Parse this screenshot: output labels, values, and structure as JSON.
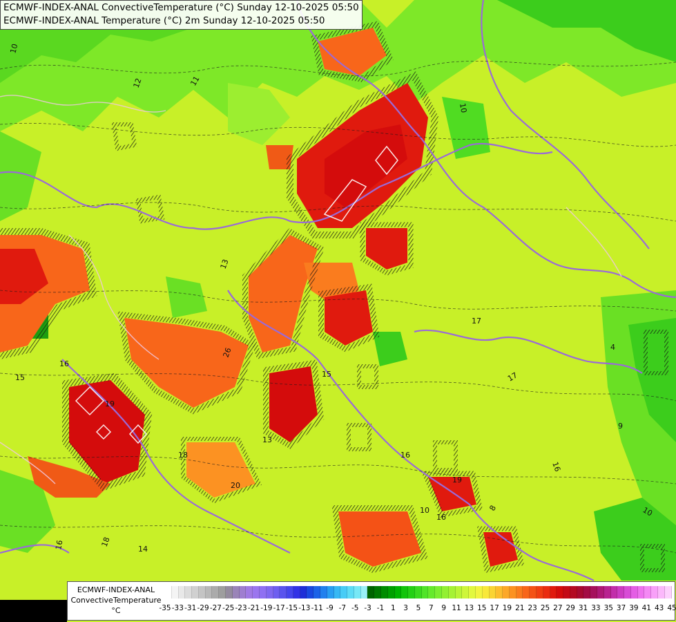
{
  "titles": {
    "line1": "ECMWF-INDEX-ANAL ConvectiveTemperature (°C) Sunday 12-10-2025 05:50",
    "line2": "ECMWF-INDEX-ANAL Temperature (°C) 2m Sunday 12-10-2025 05:50"
  },
  "legend": {
    "model": "ECMWF-INDEX-ANAL",
    "parameter": "ConvectiveTemperature",
    "unit": "°C",
    "labels": [
      "-35",
      "-33",
      "-31",
      "-29",
      "-27",
      "-25",
      "-23",
      "-21",
      "-19",
      "-17",
      "-15",
      "-13",
      "-11",
      "-9",
      "-7",
      "-5",
      "-3",
      "-1",
      "1",
      "3",
      "5",
      "7",
      "9",
      "11",
      "13",
      "15",
      "17",
      "19",
      "21",
      "23",
      "25",
      "27",
      "29",
      "31",
      "33",
      "35",
      "37",
      "39",
      "41",
      "43",
      "45"
    ],
    "colors": [
      "#ffffff",
      "#f4f4f4",
      "#e8e8e8",
      "#dcdcdc",
      "#d0d0d0",
      "#c4c4c4",
      "#b8b8b8",
      "#ababab",
      "#9e9e9e",
      "#948b9e",
      "#9a84b8",
      "#9f7ed0",
      "#a17ae4",
      "#9b76ee",
      "#8f70f2",
      "#8068f0",
      "#6e5ef0",
      "#5a54ee",
      "#4646ec",
      "#3232e6",
      "#1e2ed8",
      "#1a48e0",
      "#1c62e8",
      "#2080ee",
      "#289ef2",
      "#36b8f4",
      "#48ccf6",
      "#5edcf6",
      "#78e8f6",
      "#9af0f8",
      "#006400",
      "#007800",
      "#008c00",
      "#00a000",
      "#00b400",
      "#12c40a",
      "#24d014",
      "#3ada1e",
      "#50e428",
      "#66ea2c",
      "#7cee30",
      "#92f032",
      "#a6f234",
      "#baf436",
      "#cef63a",
      "#e2f83e",
      "#f2f440",
      "#f8e83a",
      "#fad434",
      "#fcbe2e",
      "#fca828",
      "#fc9222",
      "#fa7c1e",
      "#f8661a",
      "#f45216",
      "#f03e12",
      "#ea2c10",
      "#e01a0e",
      "#d40c0c",
      "#c40a16",
      "#b40a22",
      "#a80a30",
      "#a40c44",
      "#a6105c",
      "#ae1876",
      "#b82290",
      "#c22eaa",
      "#cc3cc2",
      "#d84cd6",
      "#e45ee4",
      "#ee72ee",
      "#f488f4",
      "#f8a0f8",
      "#fbb8fb",
      "#fdd0fd"
    ],
    "note_colors": "swatches run from white/gray through purple, blue, cyan, green, yellow, orange, red to magenta"
  },
  "map": {
    "contour_labels": [
      "10",
      "12",
      "11",
      "10",
      "13",
      "17",
      "16",
      "19",
      "26",
      "15",
      "14",
      "16",
      "18",
      "20",
      "17",
      "16",
      "9",
      "4",
      "10",
      "19",
      "16",
      "8",
      "15",
      "18",
      "16",
      "10",
      "13"
    ],
    "hot_spots": "convective temperature maxima in red/orange cells",
    "accent_colors": {
      "background_field": "#c8f028",
      "warm": "#f05a12",
      "hot": "#e01010",
      "cool": "#3ad81e",
      "border_line": "#9a6ad8"
    }
  }
}
